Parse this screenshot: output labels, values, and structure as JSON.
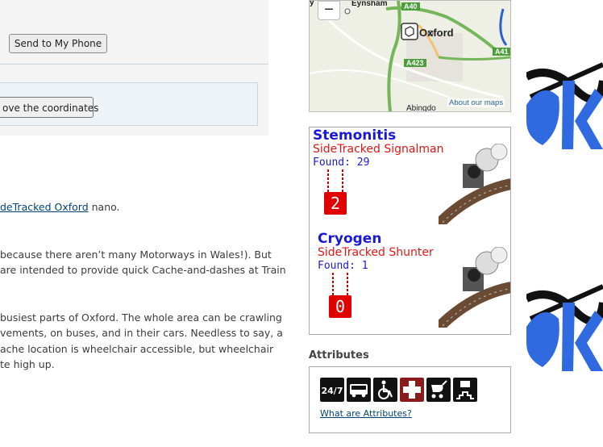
{
  "actions": {
    "send_to_phone": "Send to My Phone",
    "solve_coords": "ove the coordinates"
  },
  "description": {
    "line1_link": "deTracked Oxford",
    "line1_suffix": " nano.",
    "p2": [
      "because there aren’t many Motorways in Wales!). But",
      "are intended to provide quick Cache-and-dashes at Train"
    ],
    "p3": [
      "busiest parts of Oxford. The whole area can be crawling",
      "vements, on buses, and in their cars. Needless to say, a",
      "ache location is wheelchair accessible, but wheelchair",
      "te high up."
    ]
  },
  "map": {
    "zoom_out": "−",
    "labels": {
      "eynsham": "Eynsham",
      "oxford": "Oxford",
      "a40": "A40",
      "a423": "A423",
      "a41": "A41",
      "abingdon": "Abingdo",
      "y": "y"
    },
    "about_link": "About our maps"
  },
  "souvenirs": [
    {
      "name": "Stemonitis",
      "title": "SideTracked Signalman",
      "found_label": "Found:",
      "found_count": "29",
      "number": "2"
    },
    {
      "name": "Cryogen",
      "title": "SideTracked Shunter",
      "found_label": "Found:",
      "found_count": "1",
      "number": "0"
    }
  ],
  "attributes": {
    "heading": "Attributes",
    "link": "What are Attributes?",
    "icons": [
      "24-7-icon",
      "bus-icon",
      "wheelchair-icon",
      "first-aid-icon",
      "stroller-icon",
      "stairs-icon"
    ],
    "icon_247_text": "24/7"
  },
  "colors": {
    "link": "#00447c",
    "souvenir_name": "#1a1ad6",
    "souvenir_title": "#e01616",
    "badge_red": "#e00000"
  }
}
